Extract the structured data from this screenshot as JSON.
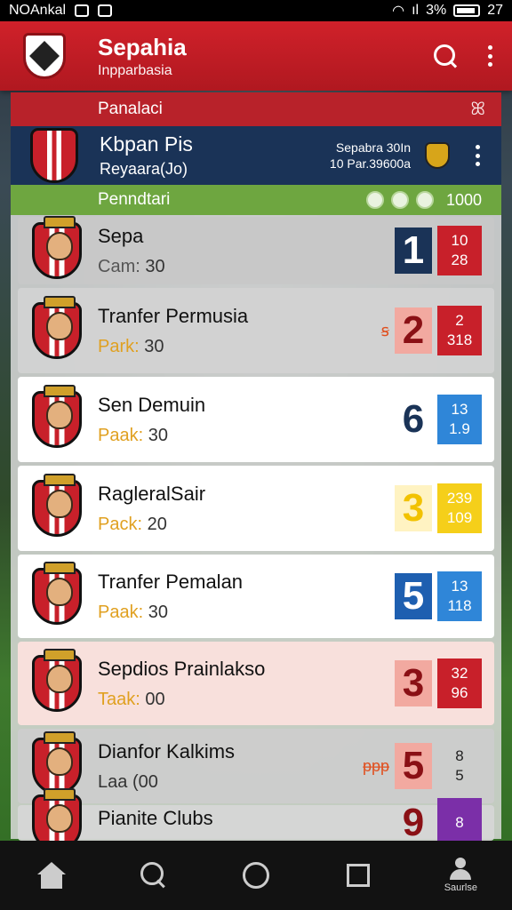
{
  "status_bar": {
    "left_text": "NOAnkal",
    "battery_text": "3%",
    "time": "27"
  },
  "app_bar": {
    "title": "Sepahia",
    "subtitle": "Inpparbasia",
    "search_icon": "search-icon",
    "more_icon": "more-vert-icon"
  },
  "panel_header": {
    "label": "Panalaci",
    "close_label": "ꕤ"
  },
  "featured": {
    "name": "Kbpan Pis",
    "sub": "Reyaara(Jo)",
    "mid_line1": "Sepabra 30In",
    "mid_line2": "10 Par.39600a"
  },
  "greenbar": {
    "label": "Penndtari",
    "count": "1000"
  },
  "rows": [
    {
      "title": "Sepa",
      "meta_k": "Cam: ",
      "meta_v": "30",
      "big": "1",
      "box1": "10",
      "box2": "28",
      "big_color": "#fff",
      "big_bg": "#1a3357",
      "box_bg": "#c8202a",
      "row_bg": "rgba(200,200,200,0.9)",
      "k_color": "#555"
    },
    {
      "title": "Tranfer Permusia",
      "meta_k": "Park: ",
      "meta_v": "30",
      "big": "2",
      "box1": "2",
      "box2": "318",
      "big_color": "#8a1015",
      "big_bg": "#f2a9a0",
      "box_bg": "#c8202a",
      "row_bg": "rgba(210,210,210,0.92)",
      "k_color": "#e0a020",
      "prefix": "ꞩ"
    },
    {
      "title": "Sen Demuin",
      "meta_k": "Paak: ",
      "meta_v": "30",
      "big": "6",
      "box1": "13",
      "box2": "1.9",
      "big_color": "#1a3357",
      "big_bg": "transparent",
      "box_bg": "#2f86d8",
      "row_bg": "#ffffff",
      "k_color": "#e0a020"
    },
    {
      "title": "RagleralSair",
      "meta_k": "Pack: ",
      "meta_v": "20",
      "big": "3",
      "box1": "239",
      "box2": "109",
      "big_color": "#f2c200",
      "big_bg": "#fff3c2",
      "box_bg": "#f5cf1a",
      "row_bg": "#ffffff",
      "k_color": "#e0a020"
    },
    {
      "title": "Tranfer Pemalan",
      "meta_k": "Paak: ",
      "meta_v": "30",
      "big": "5",
      "box1": "13",
      "box2": "118",
      "big_color": "#ffffff",
      "big_bg": "#1e5fb0",
      "box_bg": "#2f86d8",
      "row_bg": "#ffffff",
      "k_color": "#e0a020"
    },
    {
      "title": "Sepdios Prainlakso",
      "meta_k": "Taak: ",
      "meta_v": "00",
      "big": "3",
      "box1": "32",
      "box2": "96",
      "big_color": "#8a1015",
      "big_bg": "#f2a9a0",
      "box_bg": "#c8202a",
      "row_bg": "#f8e0dc",
      "k_color": "#e0a020"
    },
    {
      "title": "Dianfor Kalkims",
      "meta_k": "Laa ",
      "meta_v": "(00",
      "big": "5",
      "box1": "8",
      "box2": "5",
      "big_color": "#8a1015",
      "big_bg": "#f2a9a0",
      "box_bg": "transparent",
      "row_bg": "rgba(205,205,205,0.92)",
      "k_color": "#333",
      "prefix": "ᵽᵽᵽ",
      "box_color": "#222"
    },
    {
      "title": "Pianite Clubs",
      "meta_k": "",
      "meta_v": "",
      "big": "9",
      "box1": "8",
      "box2": "",
      "big_color": "#8a1015",
      "big_bg": "transparent",
      "box_bg": "#7b2fa8",
      "row_bg": "rgba(215,215,215,0.92)",
      "k_color": "#333"
    }
  ],
  "nav": {
    "person_label": "Saurlse"
  }
}
